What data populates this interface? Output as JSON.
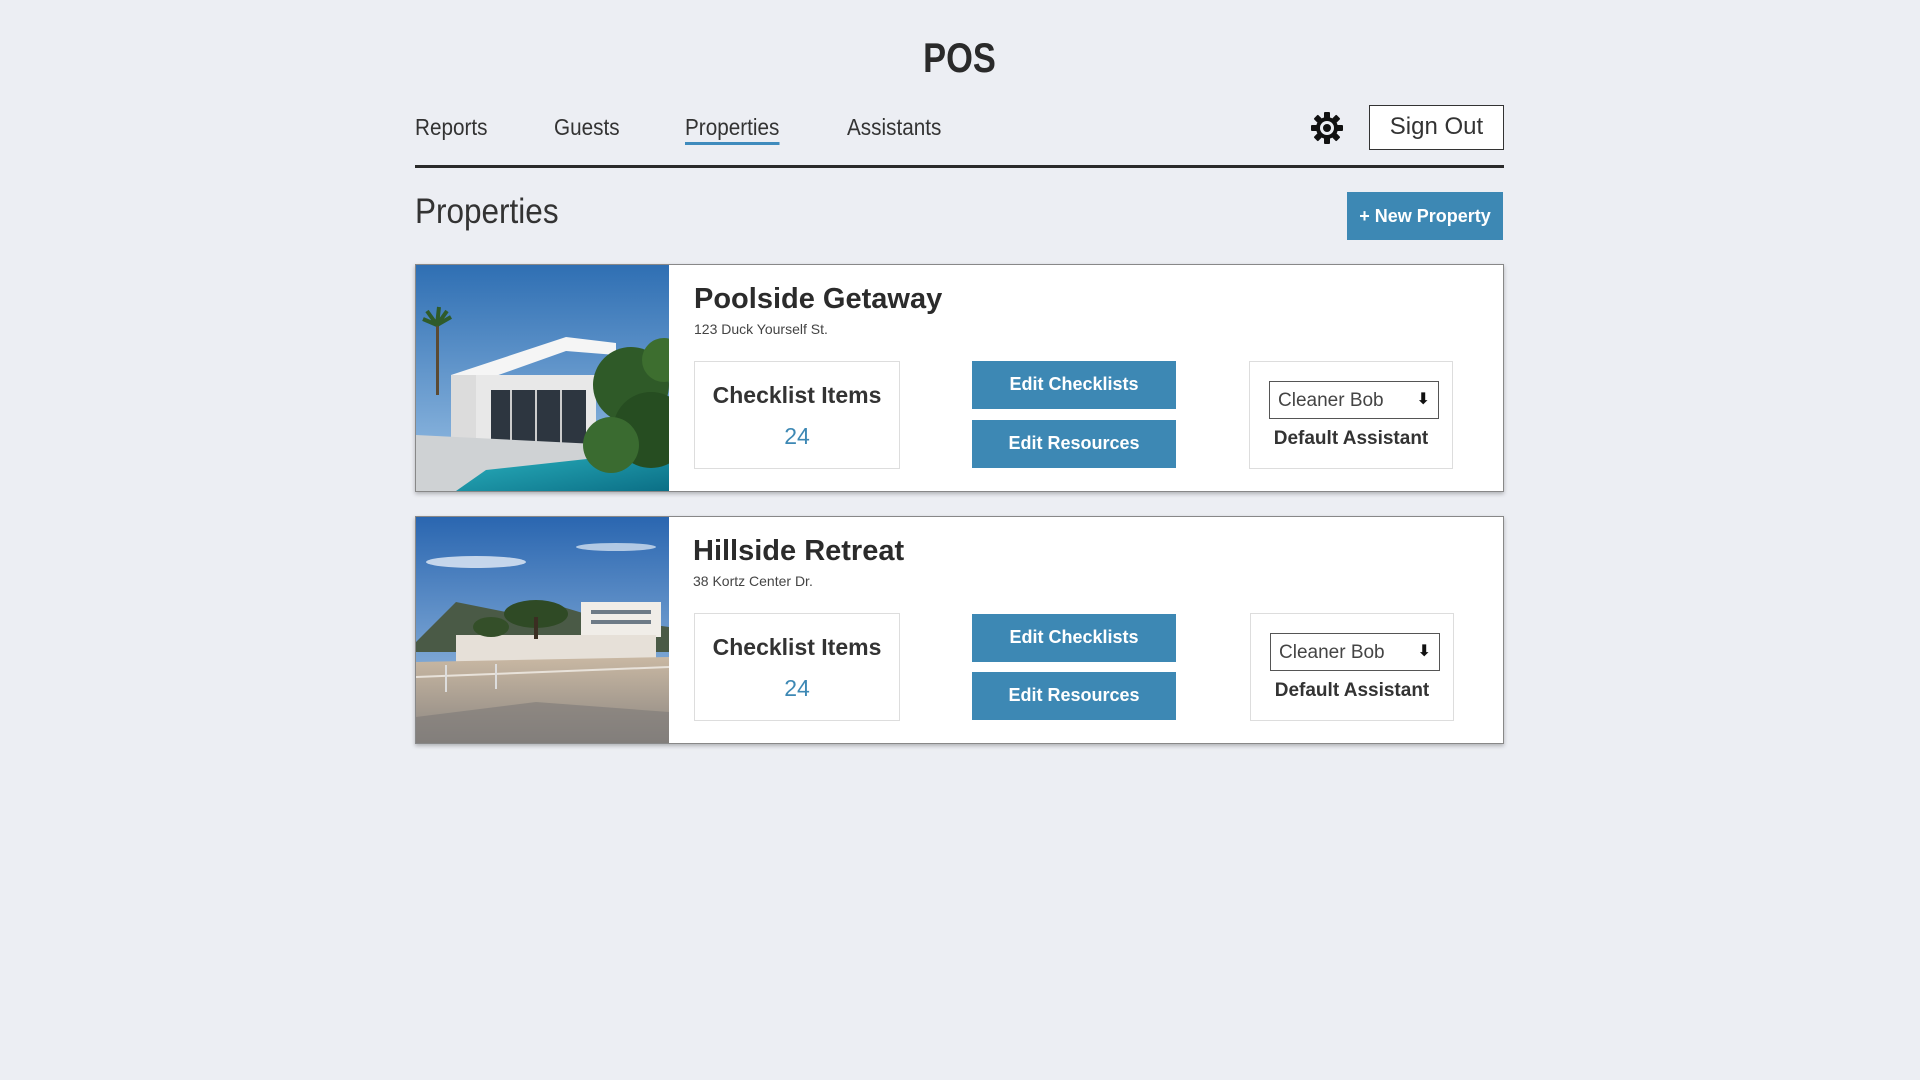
{
  "app": {
    "title": "POS"
  },
  "nav": {
    "items": [
      {
        "label": "Reports"
      },
      {
        "label": "Guests"
      },
      {
        "label": "Properties",
        "active": true
      },
      {
        "label": "Assistants"
      }
    ],
    "settings_icon": "gear-icon",
    "signout_label": "Sign Out"
  },
  "page": {
    "title": "Properties",
    "new_button_label": "+ New Property"
  },
  "properties": [
    {
      "name": "Poolside Getaway",
      "address": "123 Duck Yourself St.",
      "checklist_label": "Checklist Items",
      "checklist_count": "24",
      "edit_checklists_label": "Edit Checklists",
      "edit_resources_label": "Edit Resources",
      "assistant_value": "Cleaner Bob",
      "assistant_label": "Default Assistant"
    },
    {
      "name": "Hillside Retreat",
      "address": "38 Kortz Center Dr.",
      "checklist_label": "Checklist Items",
      "checklist_count": "24",
      "edit_checklists_label": "Edit Checklists",
      "edit_resources_label": "Edit Resources",
      "assistant_value": "Cleaner Bob",
      "assistant_label": "Default Assistant"
    }
  ],
  "colors": {
    "background": "#eceef3",
    "accent": "#3d88b4",
    "text": "#333333"
  }
}
